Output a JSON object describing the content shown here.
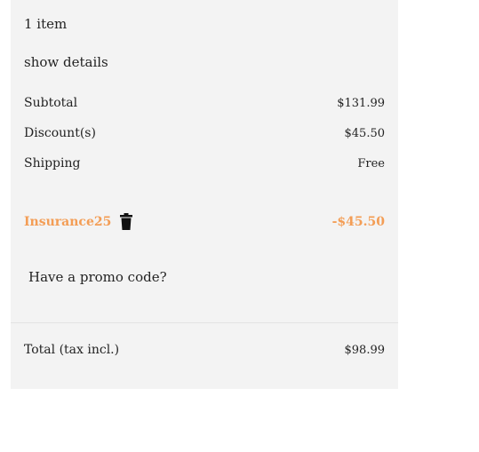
{
  "summary": {
    "items_count": "1 item",
    "show_details": "show details",
    "lines": [
      {
        "label": "Subtotal",
        "value": "$131.99"
      },
      {
        "label": "Discount(s)",
        "value": "$45.50"
      },
      {
        "label": "Shipping",
        "value": "Free"
      }
    ],
    "voucher": {
      "code": "Insurance25",
      "amount": "-$45.50",
      "remove_icon": "trash-icon"
    },
    "promo_link": "Have a promo code?",
    "total": {
      "label": "Total (tax incl.)",
      "value": "$98.99"
    }
  },
  "colors": {
    "panel_background": "#f3f3f3",
    "accent": "#f39d55",
    "text": "#232323",
    "divider": "#e2e2e2"
  }
}
